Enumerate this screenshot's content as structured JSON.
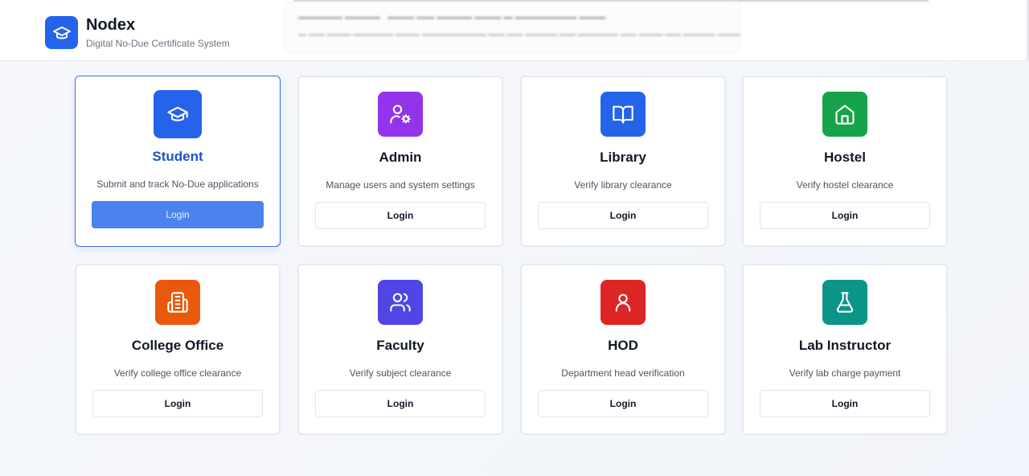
{
  "app": {
    "name": "Nodex",
    "subtitle": "Digital No-Due Certificate System",
    "logo_icon": "graduation-cap-icon",
    "accent_color": "#2563eb"
  },
  "roles": [
    {
      "id": "student",
      "title": "Student",
      "description": "Submit and track No-Due applications",
      "button_label": "Login",
      "icon": "graduation-cap-icon",
      "icon_color": "#2563eb",
      "selected": true
    },
    {
      "id": "admin",
      "title": "Admin",
      "description": "Manage users and system settings",
      "button_label": "Login",
      "icon": "user-cog-icon",
      "icon_color": "#9333ea",
      "selected": false
    },
    {
      "id": "library",
      "title": "Library",
      "description": "Verify library clearance",
      "button_label": "Login",
      "icon": "book-open-icon",
      "icon_color": "#2563eb",
      "selected": false
    },
    {
      "id": "hostel",
      "title": "Hostel",
      "description": "Verify hostel clearance",
      "button_label": "Login",
      "icon": "home-icon",
      "icon_color": "#16a34a",
      "selected": false
    },
    {
      "id": "college-office",
      "title": "College Office",
      "description": "Verify college office clearance",
      "button_label": "Login",
      "icon": "building-icon",
      "icon_color": "#ea580c",
      "selected": false
    },
    {
      "id": "faculty",
      "title": "Faculty",
      "description": "Verify subject clearance",
      "button_label": "Login",
      "icon": "users-icon",
      "icon_color": "#4f46e5",
      "selected": false
    },
    {
      "id": "hod",
      "title": "HOD",
      "description": "Department head verification",
      "button_label": "Login",
      "icon": "user-icon",
      "icon_color": "#dc2626",
      "selected": false
    },
    {
      "id": "lab-instructor",
      "title": "Lab Instructor",
      "description": "Verify lab charge payment",
      "button_label": "Login",
      "icon": "flask-icon",
      "icon_color": "#0d9488",
      "selected": false
    }
  ]
}
